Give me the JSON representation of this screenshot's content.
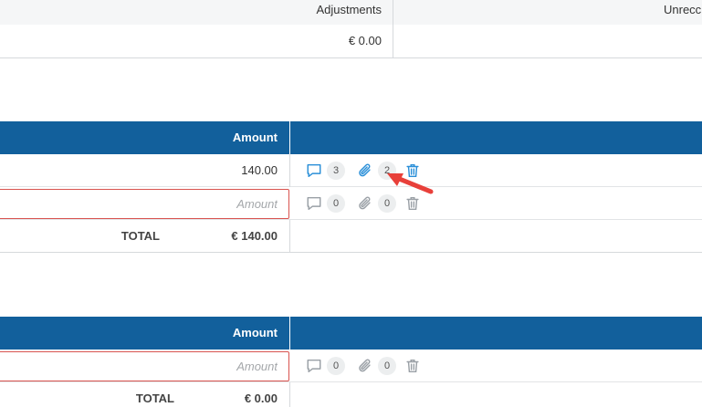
{
  "summary": {
    "adjustments_header": "Adjustments",
    "unreconciled_header": "Unrecc",
    "adjustments_value": "€ 0.00"
  },
  "section1": {
    "amount_header": "Amount",
    "rows": [
      {
        "amount": "140.00",
        "comments": "3",
        "attachments": "2"
      },
      {
        "amount_placeholder": "Amount",
        "comments": "0",
        "attachments": "0"
      }
    ],
    "total_label": "TOTAL",
    "total_value": "€ 140.00"
  },
  "section2": {
    "amount_header": "Amount",
    "rows": [
      {
        "amount_placeholder": "Amount",
        "comments": "0",
        "attachments": "0"
      }
    ],
    "total_label": "TOTAL",
    "total_value": "€ 0.00"
  },
  "icons": [
    "comment-icon",
    "paperclip-icon",
    "trash-icon",
    "red-arrow-annotation"
  ],
  "colors": {
    "header_bg": "#12609c",
    "active_icon": "#2a8fd8",
    "inactive_icon": "#9aa0a6",
    "error_border": "#d9534f",
    "arrow": "#e8403a"
  }
}
